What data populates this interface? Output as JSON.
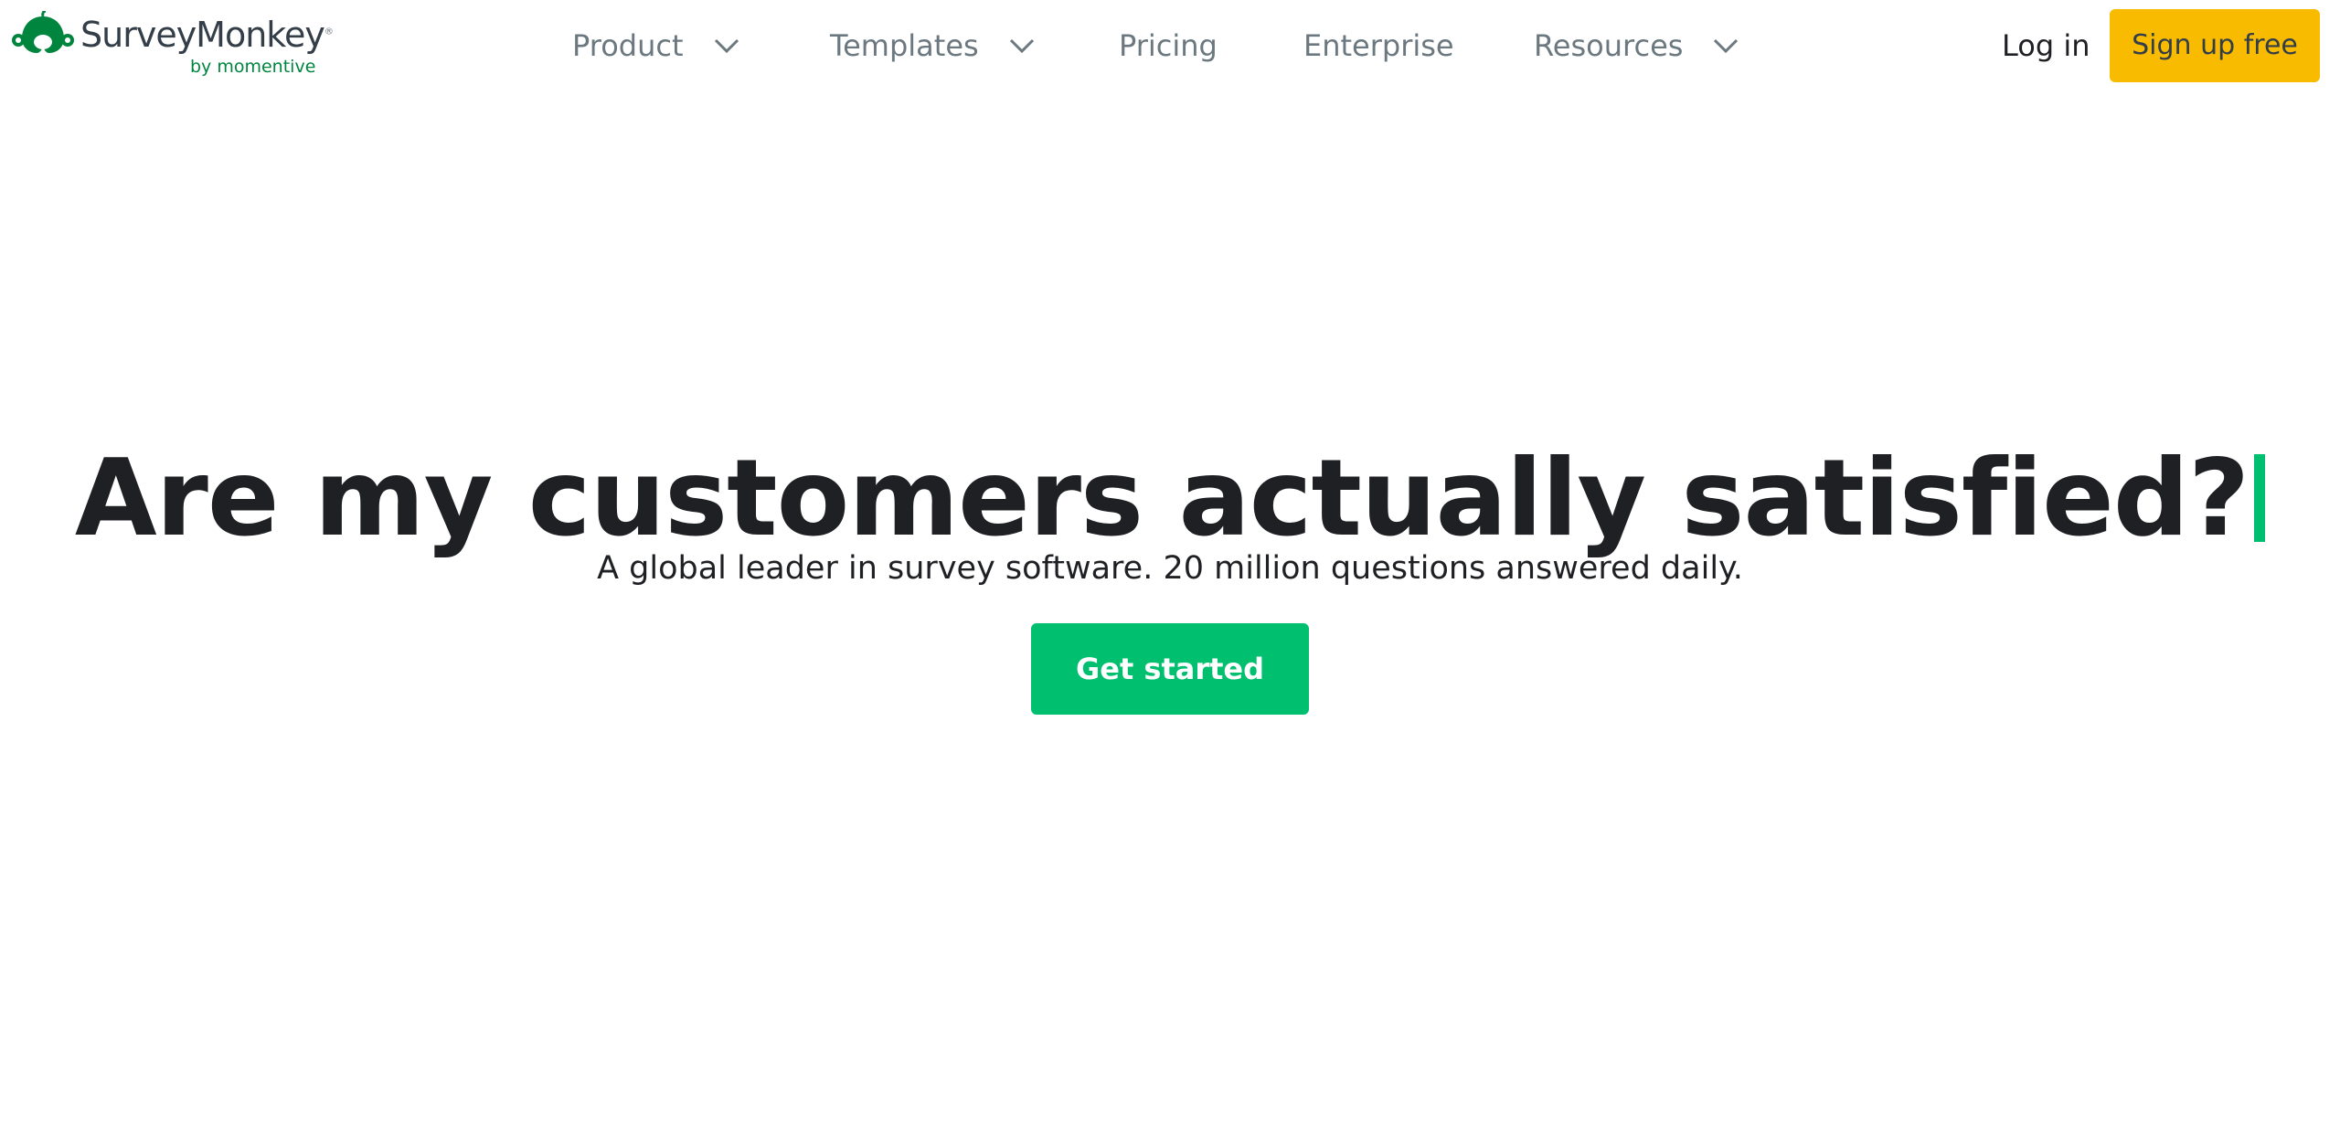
{
  "brand": {
    "name": "SurveyMonkey",
    "registered_mark": "®",
    "byline": "by momentive",
    "logo_icon": "surveymonkey-logo-icon",
    "colors": {
      "green": "#00bf6f",
      "dark_green": "#00853f",
      "yellow": "#f8bb00",
      "text_dark": "#1f2024",
      "nav_gray": "#6b787f"
    }
  },
  "nav": {
    "items": [
      {
        "label": "Product",
        "has_dropdown": true,
        "icon": "chevron-down-icon"
      },
      {
        "label": "Templates",
        "has_dropdown": true,
        "icon": "chevron-down-icon"
      },
      {
        "label": "Pricing",
        "has_dropdown": false
      },
      {
        "label": "Enterprise",
        "has_dropdown": false
      },
      {
        "label": "Resources",
        "has_dropdown": true,
        "icon": "chevron-down-icon"
      }
    ]
  },
  "auth": {
    "login_label": "Log in",
    "signup_label": "Sign up free"
  },
  "hero": {
    "title": "Are my customers actually satisfied?",
    "subtitle": "A global leader in survey software. 20 million questions answered daily.",
    "cta_label": "Get started"
  }
}
